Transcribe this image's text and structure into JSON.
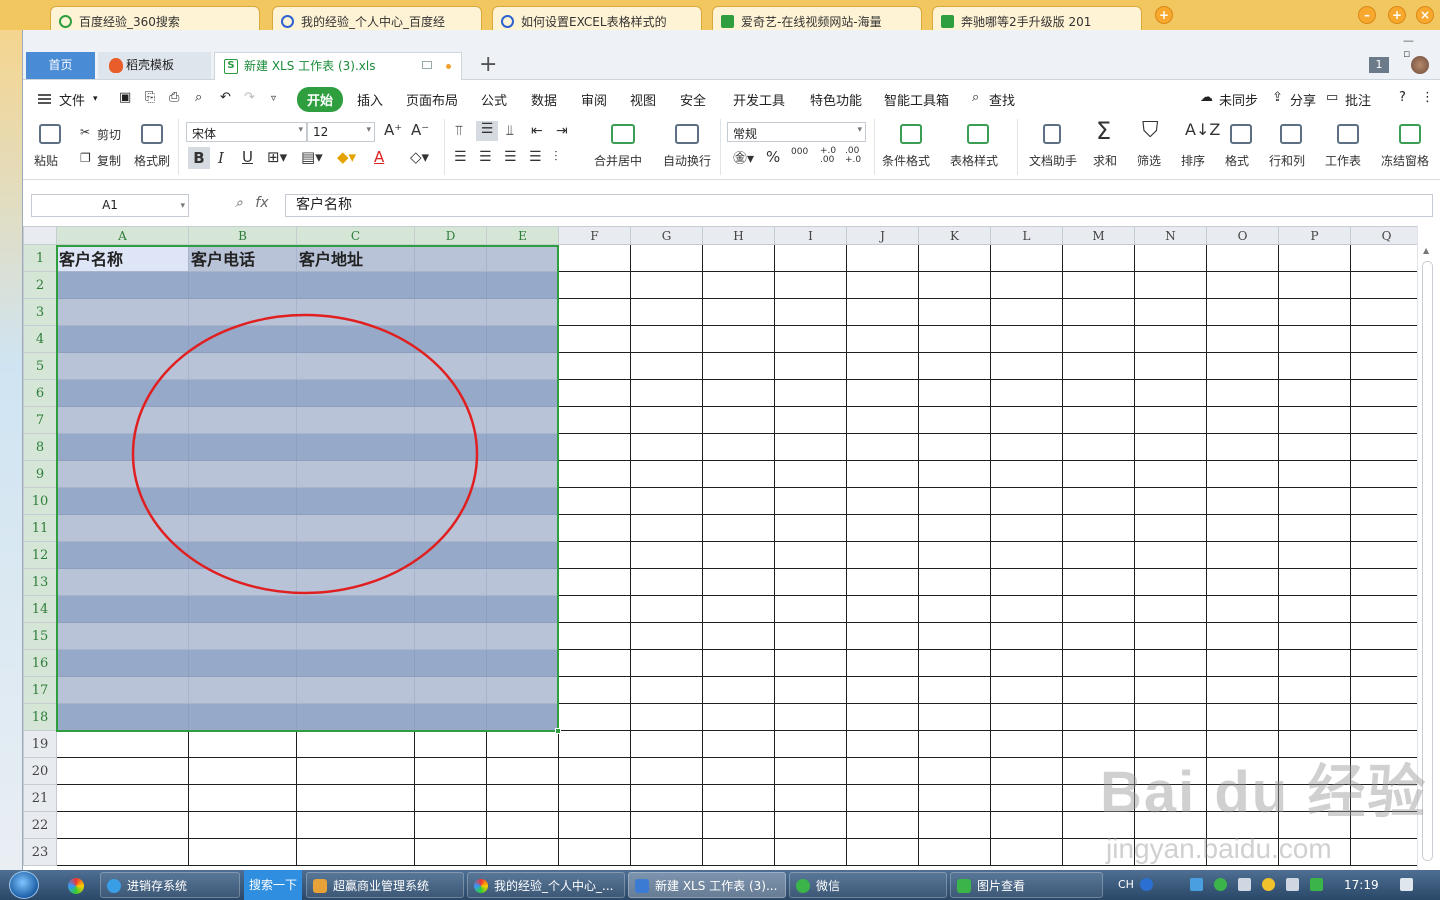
{
  "browser": {
    "tabs": [
      "百度经验_360搜索",
      "我的经验_个人中心_百度经",
      "如何设置EXCEL表格样式的",
      "爱奇艺-在线视频网站-海量",
      "奔驰哪等2手升级版 201"
    ]
  },
  "wps": {
    "doc_tabs": {
      "home": "首页",
      "template": "稻壳模板",
      "file": "新建 XLS 工作表 (3).xls",
      "file_icon": "S",
      "counter": "1"
    },
    "menu": {
      "file": "文件",
      "items": [
        "开始",
        "插入",
        "页面布局",
        "公式",
        "数据",
        "审阅",
        "视图",
        "安全",
        "开发工具",
        "特色功能",
        "智能工具箱"
      ],
      "search": "查找",
      "right": [
        "未同步",
        "分享",
        "批注",
        "?"
      ]
    },
    "ribbon": {
      "paste": "粘贴",
      "cut": "剪切",
      "copy": "复制",
      "format_painter": "格式刷",
      "font_name": "宋体",
      "font_size": "12",
      "merge_center": "合并居中",
      "wrap_text": "自动换行",
      "number_format": "常规",
      "conditional_format": "条件格式",
      "table_style": "表格样式",
      "doc_helper": "文档助手",
      "sum": "求和",
      "filter": "筛选",
      "sort": "排序",
      "format": "格式",
      "row_col": "行和列",
      "worksheet": "工作表",
      "freeze": "冻结窗格",
      "bold": "B",
      "italic": "I",
      "underline": "U",
      "font_color": "A",
      "percent": "%",
      "thousands": "000",
      "inc_decimal": "+.0 .00",
      "dec_decimal": ".00 +.0"
    },
    "formula_bar": {
      "name_box": "A1",
      "fx": "fx",
      "content": "客户名称"
    }
  },
  "sheet": {
    "columns": [
      "A",
      "B",
      "C",
      "D",
      "E",
      "F",
      "G",
      "H",
      "I",
      "J",
      "K",
      "L",
      "M",
      "N",
      "O",
      "P",
      "Q"
    ],
    "rows": [
      "1",
      "2",
      "3",
      "4",
      "5",
      "6",
      "7",
      "8",
      "9",
      "10",
      "11",
      "12",
      "13",
      "14",
      "15",
      "16",
      "17",
      "18",
      "19",
      "20",
      "21",
      "22",
      "23"
    ],
    "header_row": [
      "客户名称",
      "客户电话",
      "客户地址",
      "",
      ""
    ],
    "selection": "A1:E18",
    "selection_color": "#2e9e3f",
    "band_dark": "#97a9c8",
    "band_light": "#b9c3d8",
    "annotation_color": "#e02020"
  },
  "watermark": {
    "brand": "Bai du 经验",
    "url": "jingyan.baidu.com"
  },
  "taskbar": {
    "items": [
      "进销存系统",
      "超赢商业管理系统",
      "我的经验_个人中心_...",
      "新建 XLS 工作表 (3)...",
      "微信",
      "图片查看"
    ],
    "search_button": "搜索一下",
    "tray_lang": "CH",
    "clock": "17:19"
  }
}
